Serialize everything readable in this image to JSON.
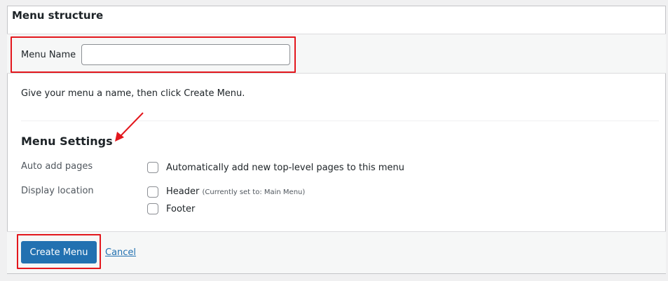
{
  "panel": {
    "title": "Menu structure"
  },
  "menu_name": {
    "label": "Menu Name",
    "value": "",
    "placeholder": ""
  },
  "hint": "Give your menu a name, then click Create Menu.",
  "settings": {
    "title": "Menu Settings",
    "auto_add": {
      "label": "Auto add pages",
      "option": "Automatically add new top-level pages to this menu"
    },
    "display_location": {
      "label": "Display location",
      "header": "Header",
      "header_note": "(Currently set to: Main Menu)",
      "footer": "Footer"
    }
  },
  "actions": {
    "create_label": "Create Menu",
    "cancel_label": "Cancel"
  },
  "colors": {
    "accent": "#2271b1",
    "highlight": "#e3171d"
  }
}
